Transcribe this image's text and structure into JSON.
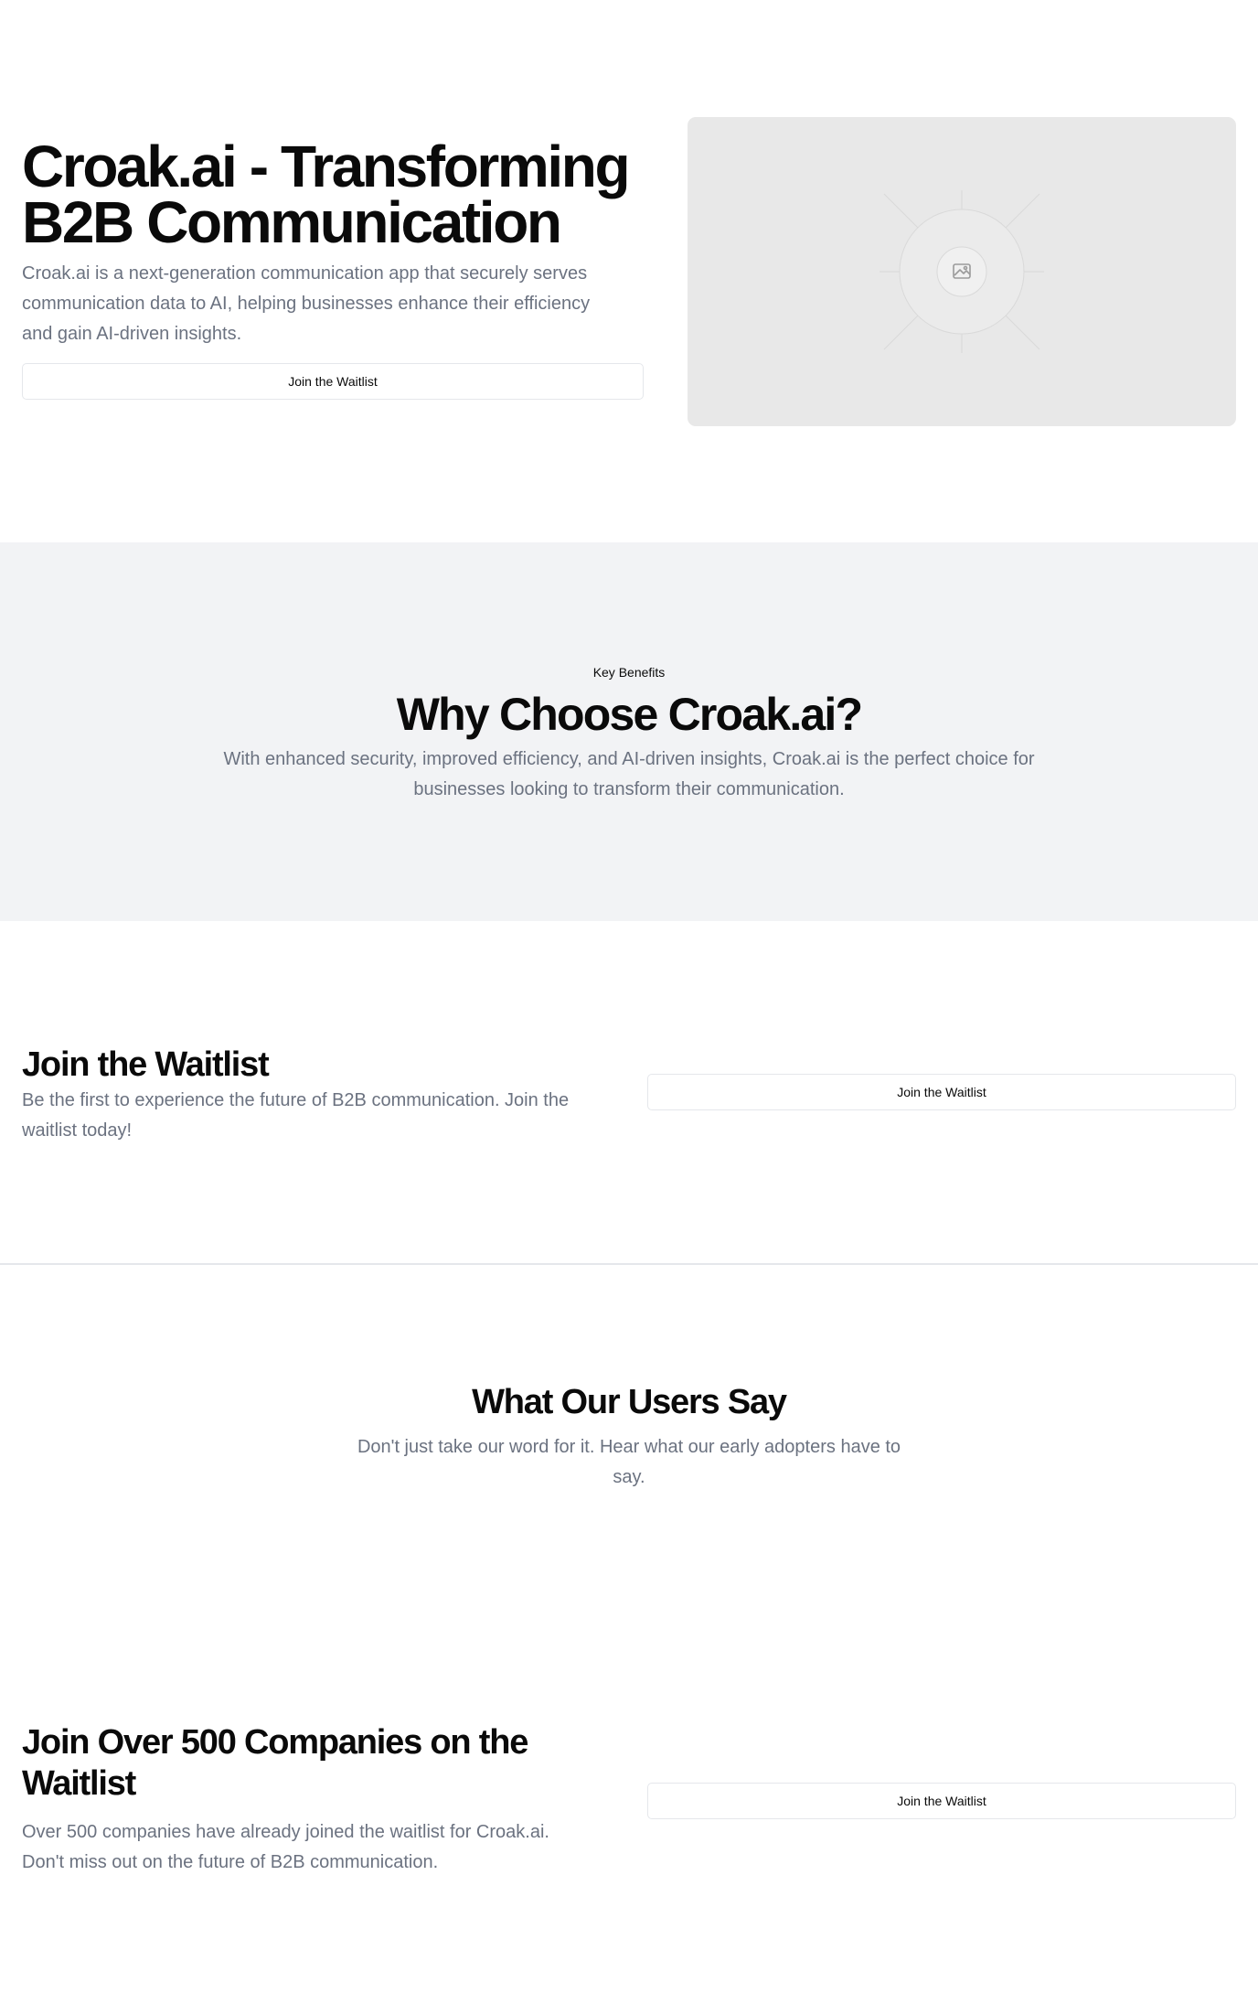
{
  "hero": {
    "title": "Croak.ai - Transforming B2B Communication",
    "description": "Croak.ai is a next-generation communication app that securely serves communication data to AI, helping businesses enhance their efficiency and gain AI-driven insights.",
    "button_label": "Join the Waitlist",
    "image_icon": "image-placeholder-icon"
  },
  "benefits": {
    "eyebrow": "Key Benefits",
    "title": "Why Choose Croak.ai?",
    "description": "With enhanced security, improved efficiency, and AI-driven insights, Croak.ai is the perfect choice for businesses looking to transform their communication."
  },
  "waitlist": {
    "title": "Join the Waitlist",
    "description": "Be the first to experience the future of B2B communication. Join the waitlist today!",
    "button_label": "Join the Waitlist"
  },
  "testimonials": {
    "title": "What Our Users Say",
    "description": "Don't just take our word for it. Hear what our early adopters have to say."
  },
  "companies": {
    "title": "Join Over 500 Companies on the Waitlist",
    "description": "Over 500 companies have already joined the waitlist for Croak.ai. Don't miss out on the future of B2B communication.",
    "button_label": "Join the Waitlist"
  },
  "colors": {
    "text": "#0a0a0a",
    "muted": "#6b7280",
    "section_bg": "#f2f3f5",
    "image_bg": "#e8e8e8",
    "border": "#e5e7eb"
  }
}
